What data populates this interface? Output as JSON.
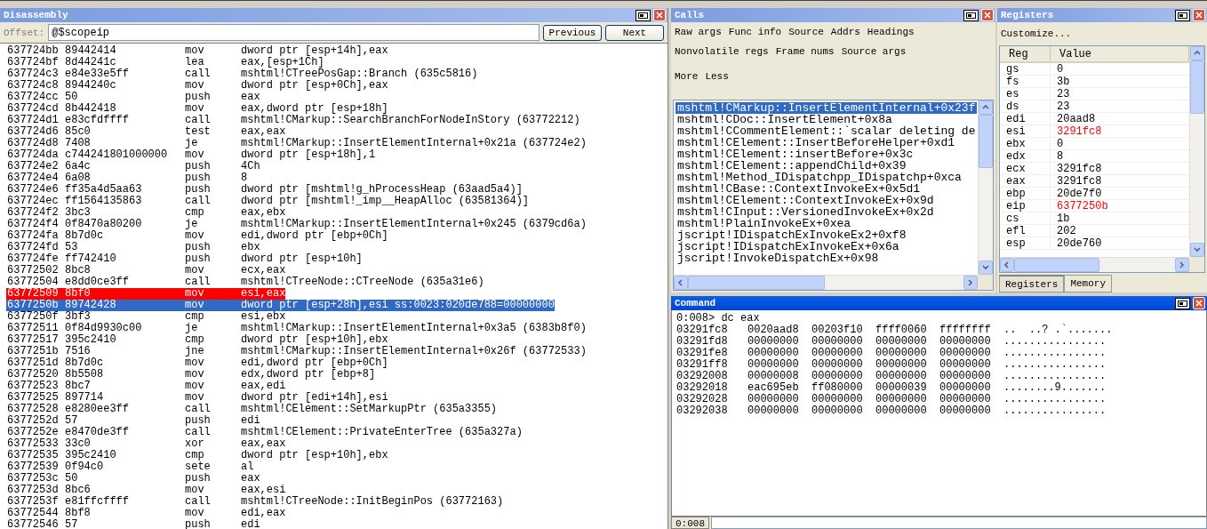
{
  "disassembly": {
    "title": "Disassembly",
    "active": false,
    "offset_label": "Offset:",
    "offset_value": "@$scopeip",
    "buttons": [
      "Previous",
      "Next"
    ],
    "rows": [
      {
        "address": "637724bb",
        "bytes": "89442414",
        "mnemonic": "mov",
        "operands": "dword ptr [esp+14h],eax",
        "breakpoint": false,
        "selected": false
      },
      {
        "address": "637724bf",
        "bytes": "8d44241c",
        "mnemonic": "lea",
        "operands": "eax,[esp+1Ch]",
        "breakpoint": false,
        "selected": false
      },
      {
        "address": "637724c3",
        "bytes": "e84e33e5ff",
        "mnemonic": "call",
        "operands": "mshtml!CTreePosGap::Branch (635c5816)",
        "breakpoint": false,
        "selected": false
      },
      {
        "address": "637724c8",
        "bytes": "8944240c",
        "mnemonic": "mov",
        "operands": "dword ptr [esp+0Ch],eax",
        "breakpoint": false,
        "selected": false
      },
      {
        "address": "637724cc",
        "bytes": "50",
        "mnemonic": "push",
        "operands": "eax",
        "breakpoint": false,
        "selected": false
      },
      {
        "address": "637724cd",
        "bytes": "8b442418",
        "mnemonic": "mov",
        "operands": "eax,dword ptr [esp+18h]",
        "breakpoint": false,
        "selected": false
      },
      {
        "address": "637724d1",
        "bytes": "e83cfdffff",
        "mnemonic": "call",
        "operands": "mshtml!CMarkup::SearchBranchForNodeInStory (63772212)",
        "breakpoint": false,
        "selected": false
      },
      {
        "address": "637724d6",
        "bytes": "85c0",
        "mnemonic": "test",
        "operands": "eax,eax",
        "breakpoint": false,
        "selected": false
      },
      {
        "address": "637724d8",
        "bytes": "7408",
        "mnemonic": "je",
        "operands": "mshtml!CMarkup::InsertElementInternal+0x21a (637724e2)",
        "breakpoint": false,
        "selected": false
      },
      {
        "address": "637724da",
        "bytes": "c744241801000000",
        "mnemonic": "mov",
        "operands": "dword ptr [esp+18h],1",
        "breakpoint": false,
        "selected": false
      },
      {
        "address": "637724e2",
        "bytes": "6a4c",
        "mnemonic": "push",
        "operands": "4Ch",
        "breakpoint": false,
        "selected": false
      },
      {
        "address": "637724e4",
        "bytes": "6a08",
        "mnemonic": "push",
        "operands": "8",
        "breakpoint": false,
        "selected": false
      },
      {
        "address": "637724e6",
        "bytes": "ff35a4d5aa63",
        "mnemonic": "push",
        "operands": "dword ptr [mshtml!g_hProcessHeap (63aad5a4)]",
        "breakpoint": false,
        "selected": false
      },
      {
        "address": "637724ec",
        "bytes": "ff1564135863",
        "mnemonic": "call",
        "operands": "dword ptr [mshtml!_imp__HeapAlloc (63581364)]",
        "breakpoint": false,
        "selected": false
      },
      {
        "address": "637724f2",
        "bytes": "3bc3",
        "mnemonic": "cmp",
        "operands": "eax,ebx",
        "breakpoint": false,
        "selected": false
      },
      {
        "address": "637724f4",
        "bytes": "0f8470a80200",
        "mnemonic": "je",
        "operands": "mshtml!CMarkup::InsertElementInternal+0x245 (6379cd6a)",
        "breakpoint": false,
        "selected": false
      },
      {
        "address": "637724fa",
        "bytes": "8b7d0c",
        "mnemonic": "mov",
        "operands": "edi,dword ptr [ebp+0Ch]",
        "breakpoint": false,
        "selected": false
      },
      {
        "address": "637724fd",
        "bytes": "53",
        "mnemonic": "push",
        "operands": "ebx",
        "breakpoint": false,
        "selected": false
      },
      {
        "address": "637724fe",
        "bytes": "ff742410",
        "mnemonic": "push",
        "operands": "dword ptr [esp+10h]",
        "breakpoint": false,
        "selected": false
      },
      {
        "address": "63772502",
        "bytes": "8bc8",
        "mnemonic": "mov",
        "operands": "ecx,eax",
        "breakpoint": false,
        "selected": false
      },
      {
        "address": "63772504",
        "bytes": "e8dd0ce3ff",
        "mnemonic": "call",
        "operands": "mshtml!CTreeNode::CTreeNode (635a31e6)",
        "breakpoint": false,
        "selected": false
      },
      {
        "address": "63772509",
        "bytes": "8bf0",
        "mnemonic": "mov",
        "operands": "esi,eax",
        "breakpoint": true,
        "selected": false
      },
      {
        "address": "6377250b",
        "bytes": "89742428",
        "mnemonic": "mov",
        "operands": "dword ptr [esp+28h],esi ss:0023:020de788=00000000",
        "breakpoint": false,
        "selected": true
      },
      {
        "address": "6377250f",
        "bytes": "3bf3",
        "mnemonic": "cmp",
        "operands": "esi,ebx",
        "breakpoint": false,
        "selected": false
      },
      {
        "address": "63772511",
        "bytes": "0f84d9930c00",
        "mnemonic": "je",
        "operands": "mshtml!CMarkup::InsertElementInternal+0x3a5 (6383b8f0)",
        "breakpoint": false,
        "selected": false
      },
      {
        "address": "63772517",
        "bytes": "395c2410",
        "mnemonic": "cmp",
        "operands": "dword ptr [esp+10h],ebx",
        "breakpoint": false,
        "selected": false
      },
      {
        "address": "6377251b",
        "bytes": "7516",
        "mnemonic": "jne",
        "operands": "mshtml!CMarkup::InsertElementInternal+0x26f (63772533)",
        "breakpoint": false,
        "selected": false
      },
      {
        "address": "6377251d",
        "bytes": "8b7d0c",
        "mnemonic": "mov",
        "operands": "edi,dword ptr [ebp+0Ch]",
        "breakpoint": false,
        "selected": false
      },
      {
        "address": "63772520",
        "bytes": "8b5508",
        "mnemonic": "mov",
        "operands": "edx,dword ptr [ebp+8]",
        "breakpoint": false,
        "selected": false
      },
      {
        "address": "63772523",
        "bytes": "8bc7",
        "mnemonic": "mov",
        "operands": "eax,edi",
        "breakpoint": false,
        "selected": false
      },
      {
        "address": "63772525",
        "bytes": "897714",
        "mnemonic": "mov",
        "operands": "dword ptr [edi+14h],esi",
        "breakpoint": false,
        "selected": false
      },
      {
        "address": "63772528",
        "bytes": "e8280ee3ff",
        "mnemonic": "call",
        "operands": "mshtml!CElement::SetMarkupPtr (635a3355)",
        "breakpoint": false,
        "selected": false
      },
      {
        "address": "6377252d",
        "bytes": "57",
        "mnemonic": "push",
        "operands": "edi",
        "breakpoint": false,
        "selected": false
      },
      {
        "address": "6377252e",
        "bytes": "e8470de3ff",
        "mnemonic": "call",
        "operands": "mshtml!CElement::PrivateEnterTree (635a327a)",
        "breakpoint": false,
        "selected": false
      },
      {
        "address": "63772533",
        "bytes": "33c0",
        "mnemonic": "xor",
        "operands": "eax,eax",
        "breakpoint": false,
        "selected": false
      },
      {
        "address": "63772535",
        "bytes": "395c2410",
        "mnemonic": "cmp",
        "operands": "dword ptr [esp+10h],ebx",
        "breakpoint": false,
        "selected": false
      },
      {
        "address": "63772539",
        "bytes": "0f94c0",
        "mnemonic": "sete",
        "operands": "al",
        "breakpoint": false,
        "selected": false
      },
      {
        "address": "6377253c",
        "bytes": "50",
        "mnemonic": "push",
        "operands": "eax",
        "breakpoint": false,
        "selected": false
      },
      {
        "address": "6377253d",
        "bytes": "8bc6",
        "mnemonic": "mov",
        "operands": "eax,esi",
        "breakpoint": false,
        "selected": false
      },
      {
        "address": "6377253f",
        "bytes": "e81ffcffff",
        "mnemonic": "call",
        "operands": "mshtml!CTreeNode::InitBeginPos (63772163)",
        "breakpoint": false,
        "selected": false
      },
      {
        "address": "63772544",
        "bytes": "8bf8",
        "mnemonic": "mov",
        "operands": "edi,eax",
        "breakpoint": false,
        "selected": false
      },
      {
        "address": "63772546",
        "bytes": "57",
        "mnemonic": "push",
        "operands": "edi",
        "breakpoint": false,
        "selected": false
      }
    ]
  },
  "calls": {
    "title": "Calls",
    "active": false,
    "option_rows": [
      [
        "Raw args",
        "Func info",
        "Source",
        "Addrs",
        "Headings"
      ],
      [
        "Nonvolatile regs",
        "Frame nums",
        "Source args"
      ],
      [
        "More",
        "Less"
      ]
    ],
    "frames": [
      {
        "text": "mshtml!CMarkup::InsertElementInternal+0x23f",
        "selected": true
      },
      {
        "text": "mshtml!CDoc::InsertElement+0x8a",
        "selected": false
      },
      {
        "text": "mshtml!CCommentElement::`scalar deleting de",
        "selected": false
      },
      {
        "text": "mshtml!CElement::InsertBeforeHelper+0xd1",
        "selected": false
      },
      {
        "text": "mshtml!CElement::insertBefore+0x3c",
        "selected": false
      },
      {
        "text": "mshtml!CElement::appendChild+0x39",
        "selected": false
      },
      {
        "text": "mshtml!Method_IDispatchpp_IDispatchp+0xca",
        "selected": false
      },
      {
        "text": "mshtml!CBase::ContextInvokeEx+0x5d1",
        "selected": false
      },
      {
        "text": "mshtml!CElement::ContextInvokeEx+0x9d",
        "selected": false
      },
      {
        "text": "mshtml!CInput::VersionedInvokeEx+0x2d",
        "selected": false
      },
      {
        "text": "mshtml!PlainInvokeEx+0xea",
        "selected": false
      },
      {
        "text": "jscript!IDispatchExInvokeEx2+0xf8",
        "selected": false
      },
      {
        "text": "jscript!IDispatchExInvokeEx+0x6a",
        "selected": false
      },
      {
        "text": "jscript!InvokeDispatchEx+0x98",
        "selected": false
      }
    ]
  },
  "registers": {
    "title": "Registers",
    "active": false,
    "customize": "Customize...",
    "columns": [
      "Reg",
      "Value"
    ],
    "rows": [
      {
        "reg": "gs",
        "value": "0",
        "changed": false
      },
      {
        "reg": "fs",
        "value": "3b",
        "changed": false
      },
      {
        "reg": "es",
        "value": "23",
        "changed": false
      },
      {
        "reg": "ds",
        "value": "23",
        "changed": false
      },
      {
        "reg": "edi",
        "value": "20aad8",
        "changed": false
      },
      {
        "reg": "esi",
        "value": "3291fc8",
        "changed": true
      },
      {
        "reg": "ebx",
        "value": "0",
        "changed": false
      },
      {
        "reg": "edx",
        "value": "8",
        "changed": false
      },
      {
        "reg": "ecx",
        "value": "3291fc8",
        "changed": false
      },
      {
        "reg": "eax",
        "value": "3291fc8",
        "changed": false
      },
      {
        "reg": "ebp",
        "value": "20de7f0",
        "changed": false
      },
      {
        "reg": "eip",
        "value": "6377250b",
        "changed": true
      },
      {
        "reg": "cs",
        "value": "1b",
        "changed": false
      },
      {
        "reg": "efl",
        "value": "202",
        "changed": false
      },
      {
        "reg": "esp",
        "value": "20de760",
        "changed": false
      }
    ],
    "tabs": [
      {
        "label": "Registers",
        "selected": true
      },
      {
        "label": "Memory",
        "selected": false
      }
    ]
  },
  "command": {
    "title": "Command",
    "active": true,
    "prompt_line": "0:008> dc eax",
    "dump": [
      {
        "address": "03291fc8",
        "words": [
          "0020aad8",
          "00203f10",
          "ffff0060",
          "ffffffff"
        ],
        "ascii": "..  ..? .`......."
      },
      {
        "address": "03291fd8",
        "words": [
          "00000000",
          "00000000",
          "00000000",
          "00000000"
        ],
        "ascii": "................"
      },
      {
        "address": "03291fe8",
        "words": [
          "00000000",
          "00000000",
          "00000000",
          "00000000"
        ],
        "ascii": "................"
      },
      {
        "address": "03291ff8",
        "words": [
          "00000000",
          "00000000",
          "00000000",
          "00000000"
        ],
        "ascii": "................"
      },
      {
        "address": "03292008",
        "words": [
          "00000008",
          "00000000",
          "00000000",
          "00000000"
        ],
        "ascii": "................"
      },
      {
        "address": "03292018",
        "words": [
          "eac695eb",
          "ff080000",
          "00000039",
          "00000000"
        ],
        "ascii": "........9......."
      },
      {
        "address": "03292028",
        "words": [
          "00000000",
          "00000000",
          "00000000",
          "00000000"
        ],
        "ascii": "................"
      },
      {
        "address": "03292038",
        "words": [
          "00000000",
          "00000000",
          "00000000",
          "00000000"
        ],
        "ascii": "................"
      }
    ],
    "input_prompt": "0:008"
  }
}
